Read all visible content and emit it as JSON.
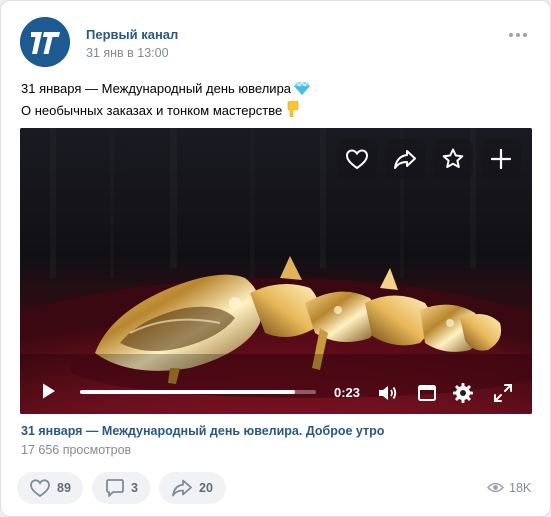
{
  "post": {
    "author": "Первый канал",
    "date": "31 янв в 13:00",
    "text_line1": "31 января — Международный день ювелира",
    "text_line2": "О необычных заказах и тонком мастерстве",
    "emoji1": "gem-icon",
    "emoji2": "pointing-down-hand-icon"
  },
  "video": {
    "time": "0:23",
    "progress": 0.91,
    "title": "31 января — Международный день ювелира. Доброе утро",
    "views": "17 656 просмотров"
  },
  "footer": {
    "likes": "89",
    "comments": "3",
    "shares": "20",
    "views": "18K"
  },
  "colors": {
    "link": "#2a5885",
    "muted": "#818c99",
    "pill_bg": "#f0f2f5",
    "avatar_bg": "#1e5b93"
  }
}
